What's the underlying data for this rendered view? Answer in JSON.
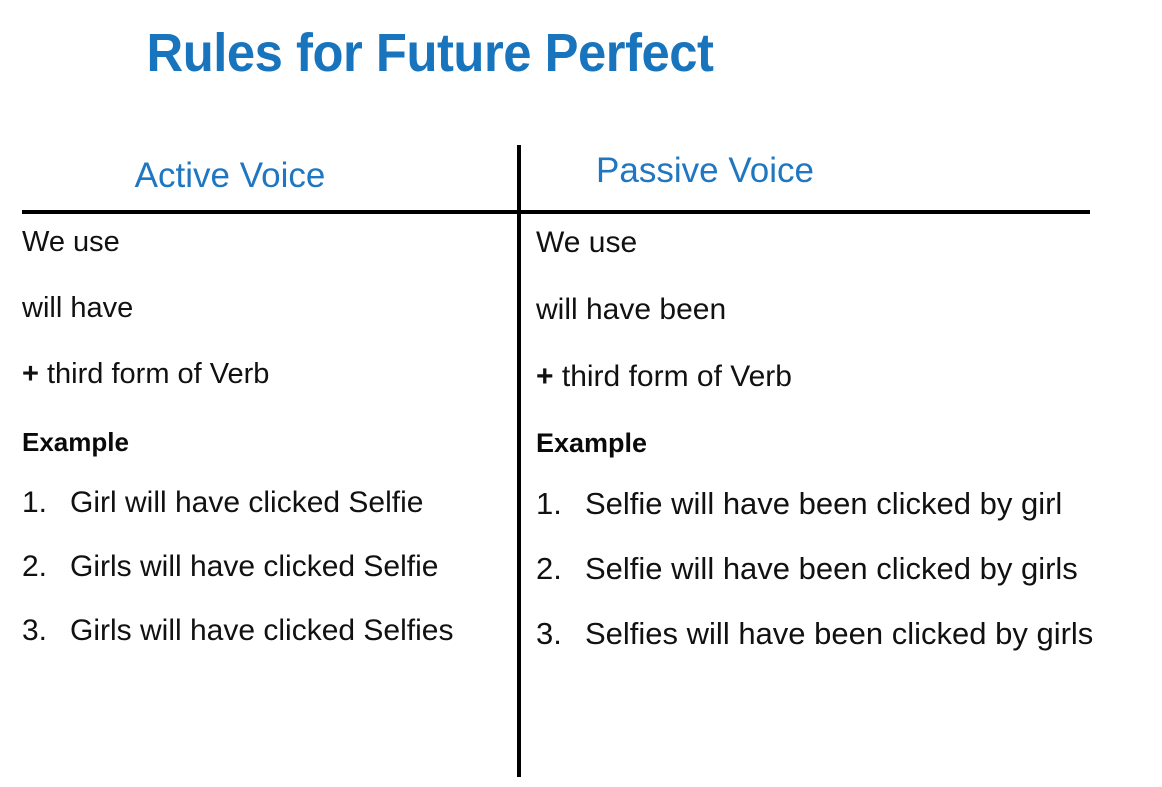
{
  "title": "Rules for Future Perfect",
  "colors": {
    "title_blue": "#1874BC",
    "header_blue": "#1F77C2",
    "text_black": "#111111",
    "rule_black": "#000000",
    "background": "#FFFFFF"
  },
  "columns": {
    "active": {
      "header": "Active Voice",
      "form": {
        "line1": "We use",
        "line2": "will have",
        "plus": "+",
        "line3": "third form of Verb"
      },
      "example_label": "Example",
      "examples": [
        {
          "marker": "1.",
          "text": "Girl will have clicked Selfie"
        },
        {
          "marker": "2.",
          "text": "Girls will have clicked Selfie"
        },
        {
          "marker": "3.",
          "text": "Girls will have clicked Selfies"
        }
      ]
    },
    "passive": {
      "header": "Passive Voice",
      "form": {
        "line1": "We use",
        "line2": "will have been",
        "plus": "+",
        "line3": "third form of Verb"
      },
      "example_label": "Example",
      "examples": [
        {
          "marker": "1.",
          "text": "Selfie will have been clicked by girl"
        },
        {
          "marker": "2.",
          "text": "Selfie will have been clicked by girls"
        },
        {
          "marker": "3.",
          "text": "Selfies will have been clicked by girls"
        }
      ]
    }
  }
}
